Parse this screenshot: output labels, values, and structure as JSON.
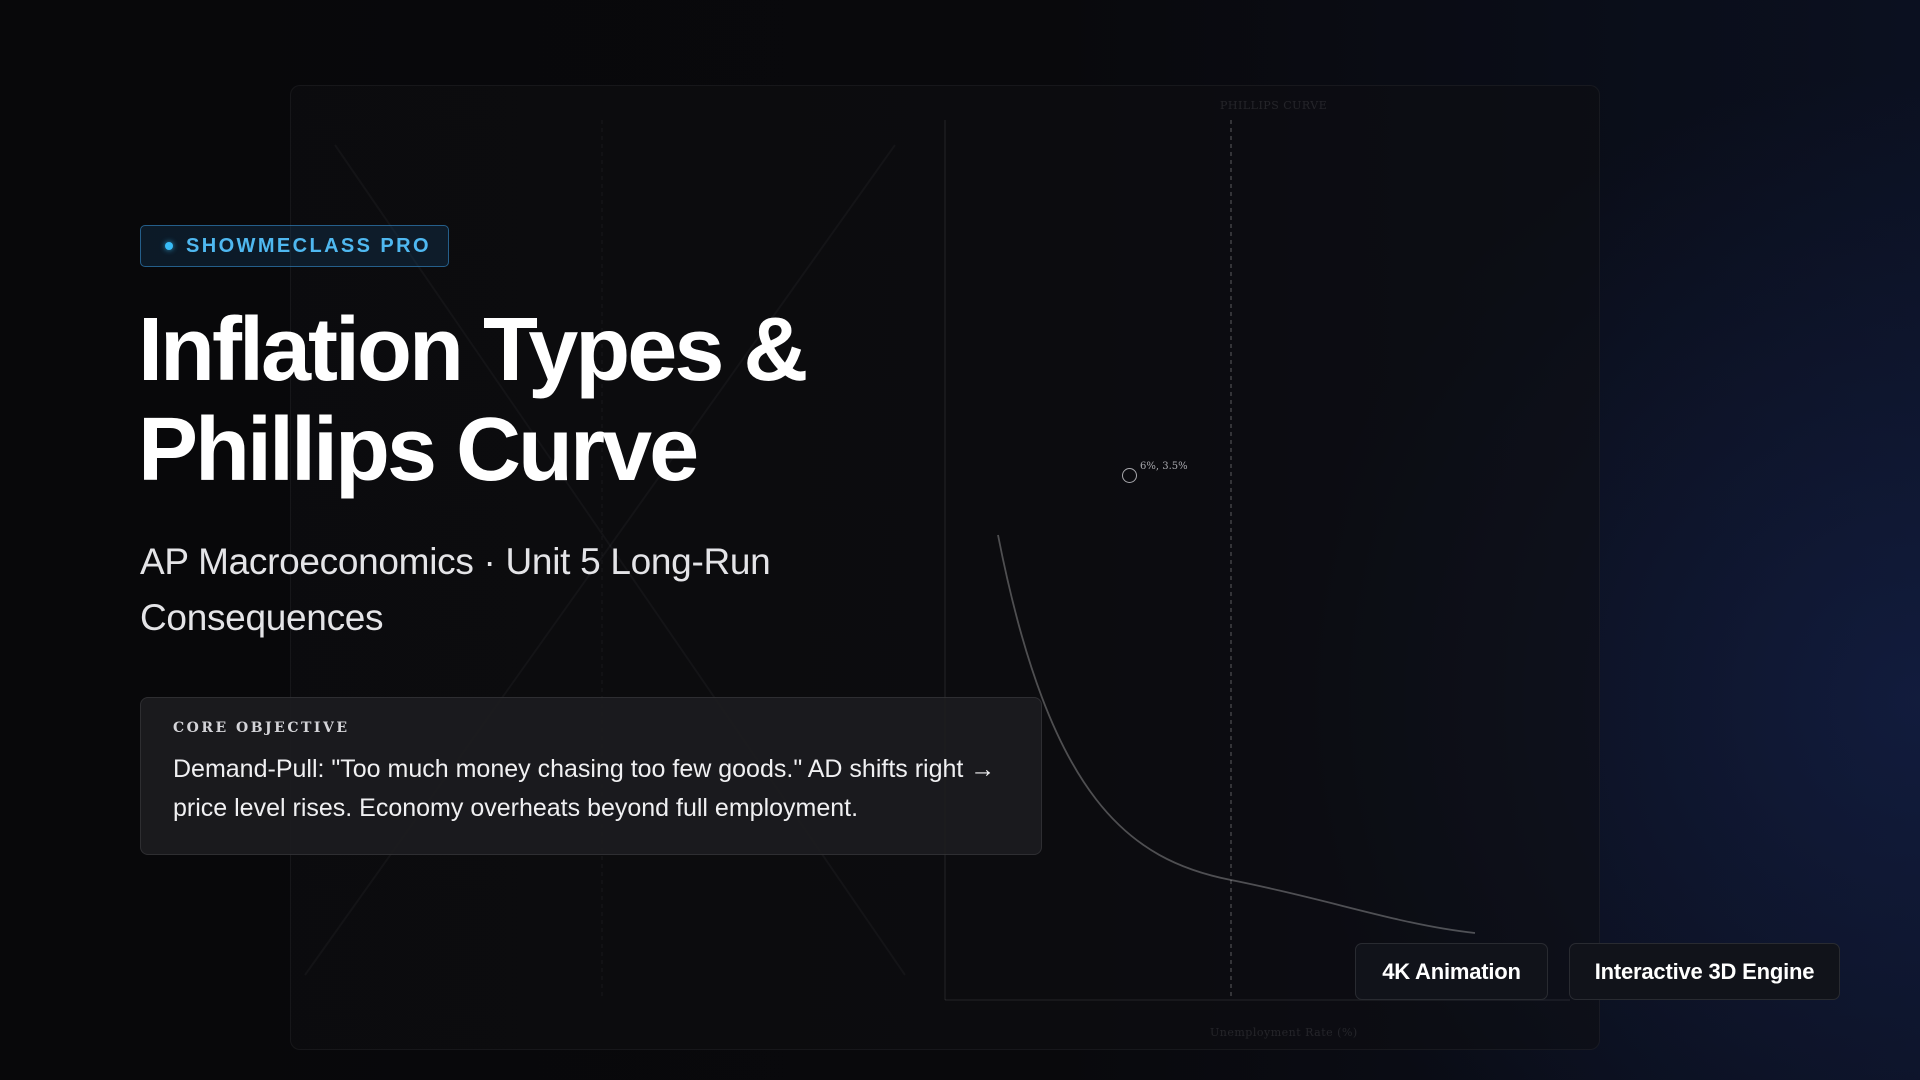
{
  "badge": {
    "label": "SHOWMECLASS PRO",
    "accent": "#38bdf8"
  },
  "title": {
    "line1": "Inflation Types &",
    "line2": "Phillips Curve"
  },
  "subtitle": "AP Macroeconomics · Unit 5 Long-Run Consequences",
  "objective": {
    "label": "CORE OBJECTIVE",
    "text": "Demand-Pull: \"Too much money chasing too few goods.\" AD shifts right → price level rises. Economy overheats beyond full employment."
  },
  "diagram": {
    "chart_title": "PHILLIPS CURVE",
    "x_axis_label": "Unemployment Rate (%)",
    "point_label": "6%, 3.5%"
  },
  "features": [
    {
      "label": "4K Animation"
    },
    {
      "label": "Interactive 3D Engine"
    }
  ]
}
